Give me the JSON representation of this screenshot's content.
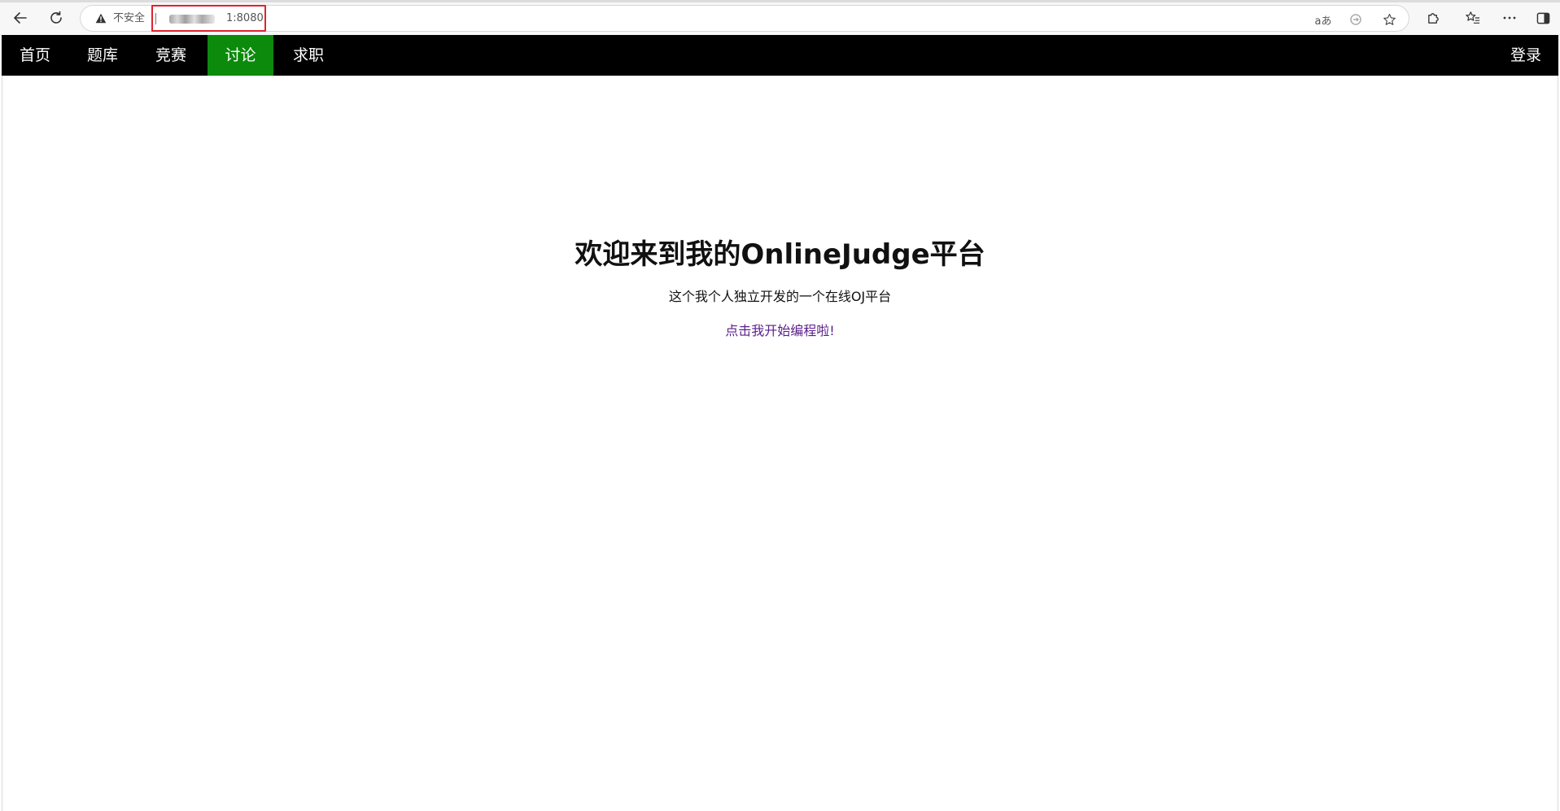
{
  "browser": {
    "address": {
      "security_label": "不安全",
      "url_visible_suffix": "1:8080"
    },
    "icons": {
      "back": "arrow-left-icon",
      "reload": "reload-icon",
      "warning": "warning-triangle-icon",
      "read_aloud": "read-aloud-icon",
      "sync": "sync-icon",
      "favorite": "star-icon",
      "extensions": "puzzle-icon",
      "favorites_bar": "favorites-list-icon",
      "more": "more-icon",
      "sidebar": "sidebar-icon"
    },
    "read_aloud_text": "aあ"
  },
  "nav": {
    "items": [
      {
        "label": "首页"
      },
      {
        "label": "题库"
      },
      {
        "label": "竞赛"
      },
      {
        "label": "讨论"
      },
      {
        "label": "求职"
      }
    ],
    "active_index": 3,
    "login_label": "登录",
    "active_color": "#0b8a0b"
  },
  "hero": {
    "title": "欢迎来到我的OnlineJudge平台",
    "subtitle": "这个我个人独立开发的一个在线OJ平台",
    "cta_link": "点击我开始编程啦!",
    "link_color": "#5b1e8c"
  }
}
